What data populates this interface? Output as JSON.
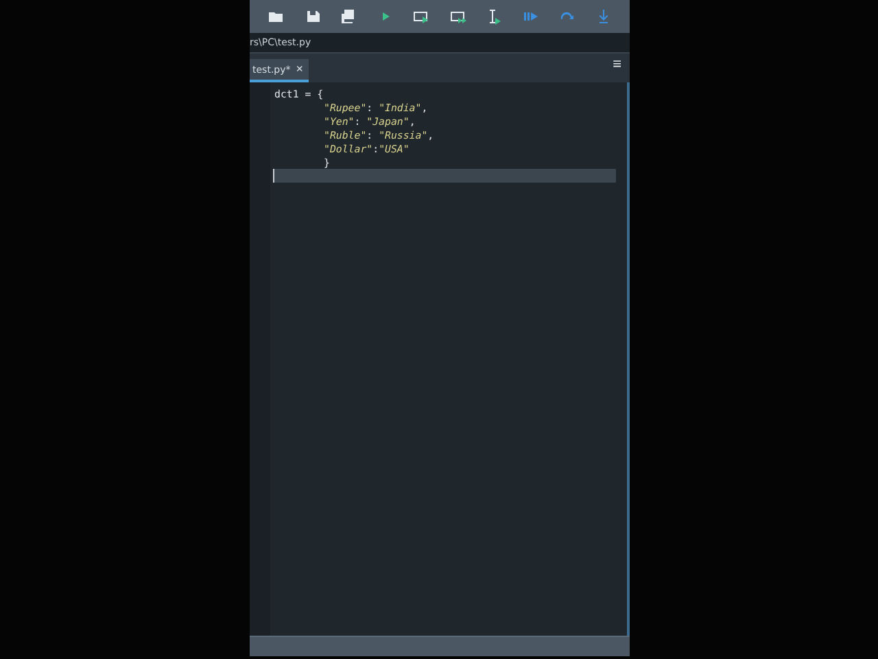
{
  "path_bar": {
    "text": "rs\\PC\\test.py"
  },
  "tabs": [
    {
      "label": "test.py*",
      "close": "×",
      "selected": true
    }
  ],
  "menu_glyph": "≡",
  "code_lines": [
    {
      "current": false,
      "indented": false,
      "tokens": [
        {
          "kind": "plain",
          "text": "dct1 = {"
        }
      ]
    },
    {
      "current": false,
      "indented": true,
      "tokens": [
        {
          "kind": "string",
          "text": "\"Rupee\""
        },
        {
          "kind": "plain",
          "text": ": "
        },
        {
          "kind": "string",
          "text": "\"India\""
        },
        {
          "kind": "plain",
          "text": ","
        }
      ]
    },
    {
      "current": false,
      "indented": true,
      "tokens": [
        {
          "kind": "string",
          "text": "\"Yen\""
        },
        {
          "kind": "plain",
          "text": ": "
        },
        {
          "kind": "string",
          "text": "\"Japan\""
        },
        {
          "kind": "plain",
          "text": ","
        }
      ]
    },
    {
      "current": false,
      "indented": true,
      "tokens": [
        {
          "kind": "string",
          "text": "\"Ruble\""
        },
        {
          "kind": "plain",
          "text": ": "
        },
        {
          "kind": "string",
          "text": "\"Russia\""
        },
        {
          "kind": "plain",
          "text": ","
        }
      ]
    },
    {
      "current": false,
      "indented": true,
      "tokens": [
        {
          "kind": "string",
          "text": "\"Dollar\""
        },
        {
          "kind": "plain",
          "text": ":"
        },
        {
          "kind": "string",
          "text": "\"USA\""
        }
      ]
    },
    {
      "current": false,
      "indented": true,
      "tokens": [
        {
          "kind": "plain",
          "text": "}"
        }
      ]
    },
    {
      "current": true,
      "indented": false
    }
  ]
}
